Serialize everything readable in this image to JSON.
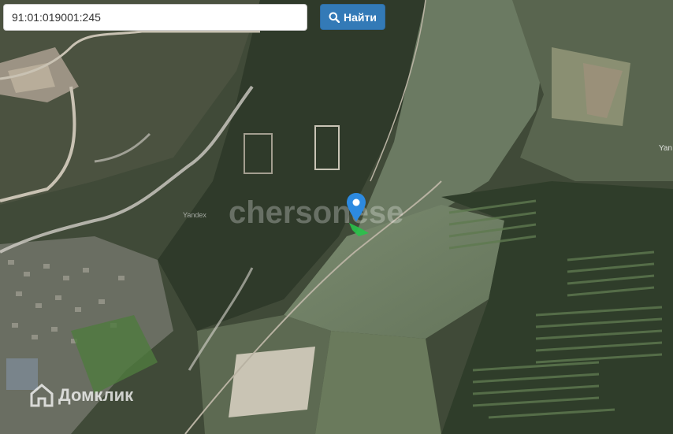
{
  "search": {
    "value": "91:01:019001:245",
    "button_label": "Найти"
  },
  "map": {
    "watermark": "chersonese",
    "brand_label": "Домклик",
    "place_label_east": "Yan",
    "place_label_west": "Yandex"
  },
  "icons": {
    "search_button": "search-icon",
    "marker": "location-pin-icon",
    "brand": "house-logo-icon"
  },
  "colors": {
    "button": "#337ab7",
    "pin": "#2d8ae0",
    "parcel": "#29c24a"
  }
}
